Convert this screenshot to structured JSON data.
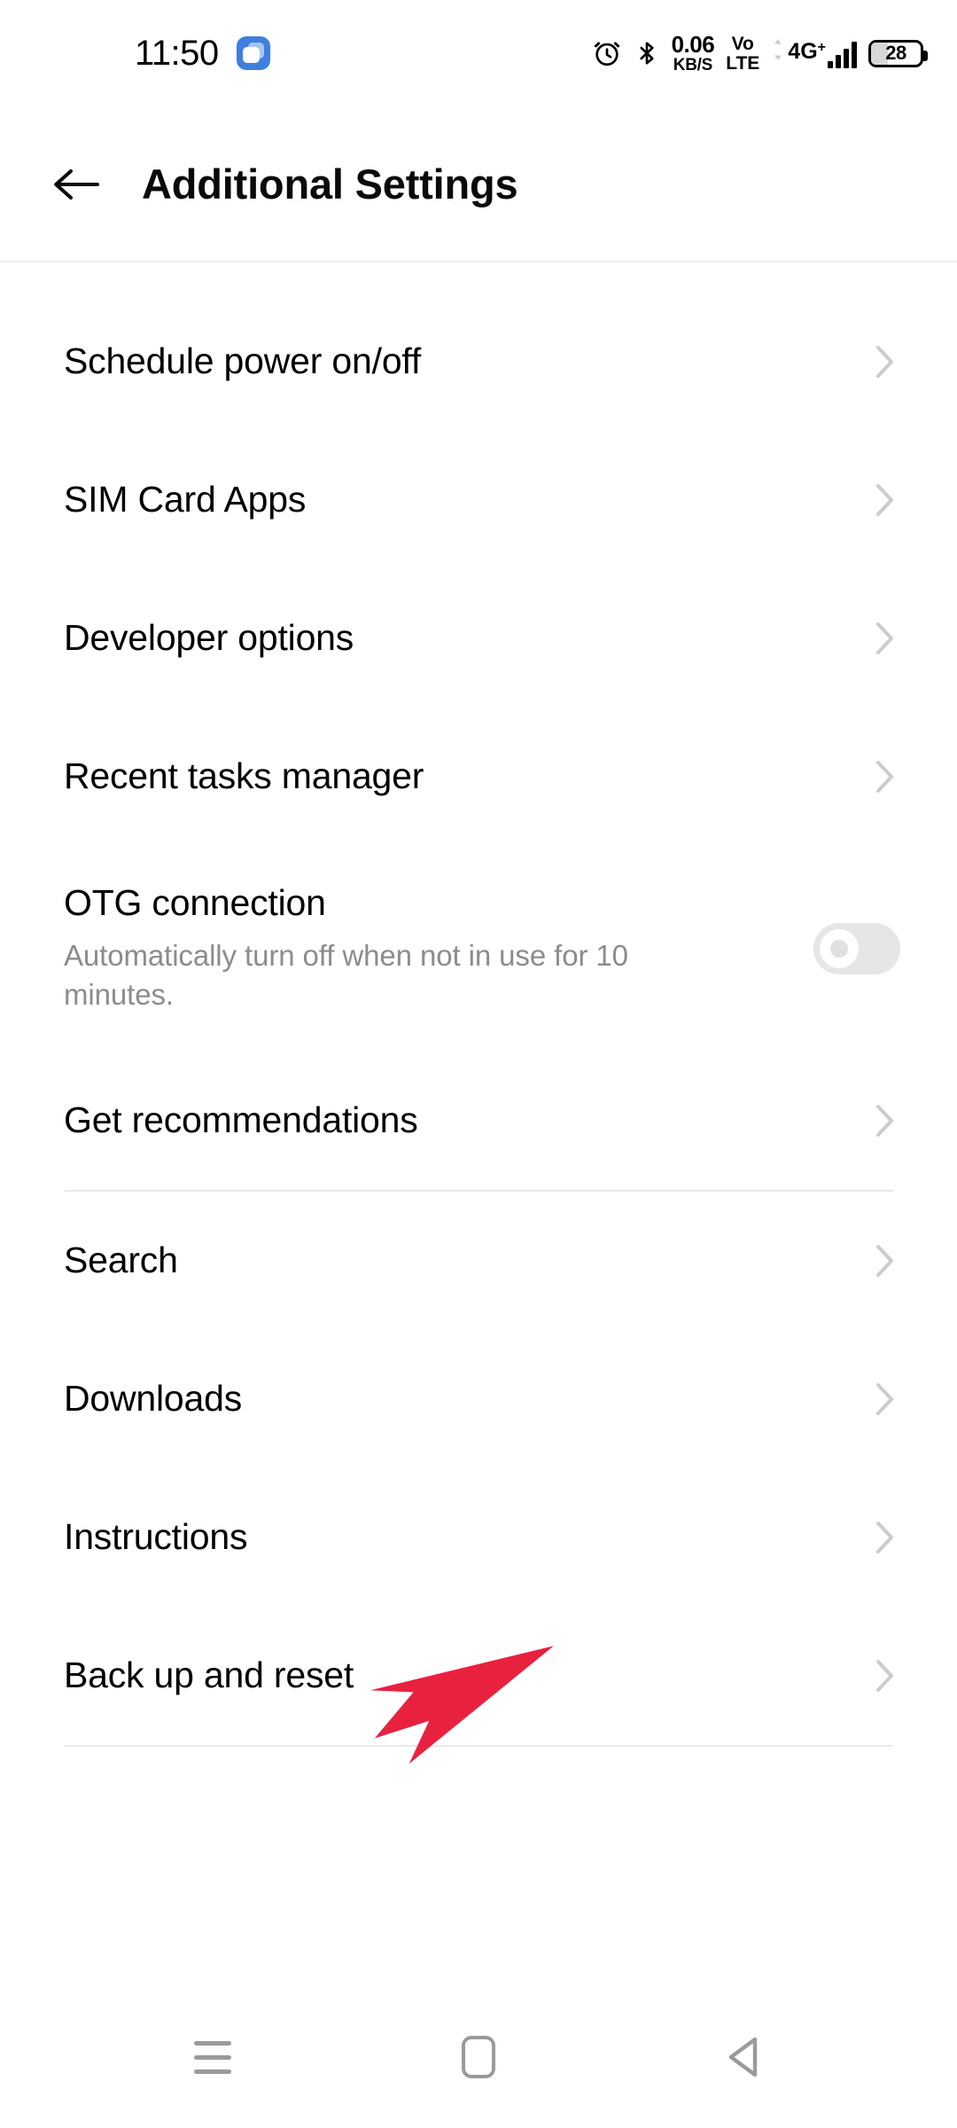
{
  "status_bar": {
    "time": "11:50",
    "app_icon": "clone-apps-icon",
    "icons": [
      "alarm-icon",
      "bluetooth-icon",
      "network-speed",
      "volte-icon",
      "signal-icon",
      "battery-icon"
    ],
    "network_speed_value": "0.06",
    "network_speed_unit": "KB/S",
    "volte_line1": "Vo",
    "volte_line2": "LTE",
    "network_generation": "4G",
    "network_generation_sup": "+",
    "signal_bars": 4,
    "battery_level": "28"
  },
  "header": {
    "back_label": "back-arrow",
    "title": "Additional Settings"
  },
  "groups": [
    {
      "id": "group-system",
      "items": [
        {
          "label": "Schedule power on/off",
          "type": "link",
          "accessory": "chevron-right-icon"
        },
        {
          "label": "SIM Card Apps",
          "type": "link",
          "accessory": "chevron-right-icon"
        },
        {
          "label": "Developer options",
          "type": "link",
          "accessory": "chevron-right-icon"
        },
        {
          "label": "Recent tasks manager",
          "type": "link",
          "accessory": "chevron-right-icon"
        },
        {
          "label": "OTG connection",
          "subtitle": "Automatically turn off when not in use for 10 minutes.",
          "type": "toggle",
          "accessory": "toggle-switch",
          "toggle_state": "off"
        },
        {
          "label": "Get recommendations",
          "type": "link",
          "accessory": "chevron-right-icon"
        }
      ]
    },
    {
      "id": "group-tools",
      "items": [
        {
          "label": "Search",
          "type": "link",
          "accessory": "chevron-right-icon"
        },
        {
          "label": "Downloads",
          "type": "link",
          "accessory": "chevron-right-icon"
        },
        {
          "label": "Instructions",
          "type": "link",
          "accessory": "chevron-right-icon"
        },
        {
          "label": "Back up and reset",
          "type": "link",
          "accessory": "chevron-right-icon"
        }
      ]
    }
  ],
  "annotation": {
    "type": "arrow",
    "color": "#E8213F",
    "points_to": "Back up and reset"
  },
  "nav_bar": {
    "buttons": [
      {
        "name": "recents-button",
        "icon": "hamburger-icon"
      },
      {
        "name": "home-button",
        "icon": "rounded-square-icon"
      },
      {
        "name": "back-button",
        "icon": "triangle-left-icon"
      }
    ]
  },
  "colors": {
    "background": "#FFFFFF",
    "title_text": "#000000",
    "subtitle_text": "#8C8C8C",
    "divider": "#E8E8E8",
    "chevron": "#CCCCCC",
    "accent_annotation": "#E8213F",
    "app_badge_blue": "#3F7FE0",
    "nav_icon": "#9A9A9A"
  }
}
